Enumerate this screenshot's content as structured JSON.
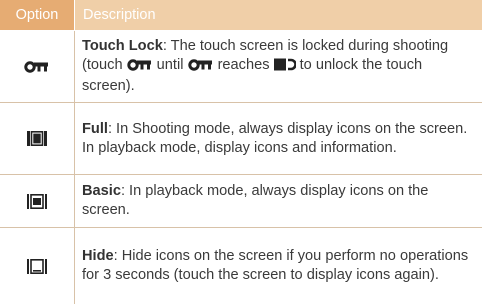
{
  "header": {
    "option": "Option",
    "description": "Description"
  },
  "rows": [
    {
      "icon": "touch-lock-key-icon",
      "term": "Touch Lock",
      "parts": [
        ": The touch screen is locked during shooting (touch ",
        " until ",
        " reaches ",
        " to unlock the touch screen)."
      ],
      "inline_icons": [
        "key-icon",
        "key-icon",
        "unlock-slot-icon"
      ]
    },
    {
      "icon": "display-full-icon",
      "term": "Full",
      "text": ": In Shooting mode, always display icons on the screen. In playback mode, display icons and information."
    },
    {
      "icon": "display-basic-icon",
      "term": "Basic",
      "text": ": In playback mode, always display icons on the screen."
    },
    {
      "icon": "display-hide-icon",
      "term": "Hide",
      "text": ": Hide icons on the screen if you perform no operations for 3 seconds (touch the screen to display icons again)."
    }
  ],
  "colors": {
    "header_option_bg": "#e6ac73",
    "header_desc_bg": "#f0cfa8",
    "rule": "#d8c2a8",
    "icon": "#222222"
  }
}
